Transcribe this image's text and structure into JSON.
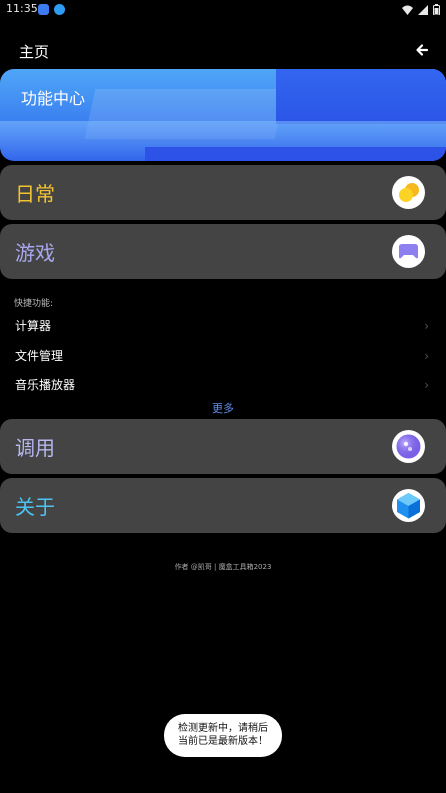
{
  "status_bar": {
    "time": "11:35",
    "app_icons": [
      "app-icon-blue",
      "download-icon"
    ],
    "system_icons": [
      "wifi-icon",
      "signal-icon",
      "battery-icon"
    ]
  },
  "header": {
    "title": "主页",
    "back_icon": "arrow-left-icon"
  },
  "banner": {
    "title": "功能中心"
  },
  "cards": [
    {
      "label": "日常",
      "color": "#f3c431",
      "icon": "yellow-circles-icon"
    },
    {
      "label": "游戏",
      "color": "#a9a7ef",
      "icon": "gamepad-icon"
    },
    {
      "label": "调用",
      "color": "#b7b6ef",
      "icon": "purple-orb-icon"
    },
    {
      "label": "关于",
      "color": "#4cc4f3",
      "icon": "blue-cube-icon"
    }
  ],
  "quick": {
    "title": "快捷功能:",
    "items": [
      {
        "label": "计算器"
      },
      {
        "label": "文件管理"
      },
      {
        "label": "音乐播放器"
      }
    ],
    "more": "更多"
  },
  "footer": "作者 @凯哥 | 魔盒工具箱2023",
  "toast": {
    "line1": "检测更新中，请稍后",
    "line2": "当前已是最新版本！"
  },
  "colors": {
    "background": "#000000",
    "card": "#444444",
    "link": "#5f8de8"
  }
}
